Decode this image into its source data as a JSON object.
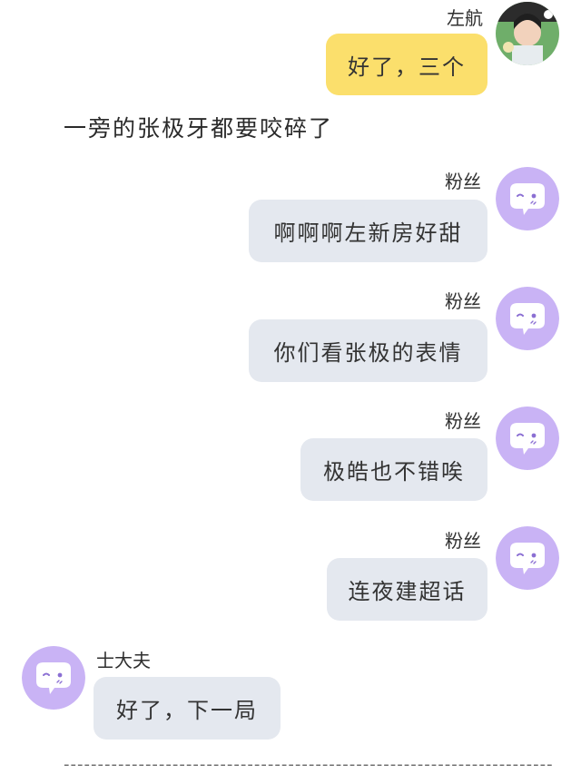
{
  "messages": [
    {
      "sender": "左航",
      "text": "好了，三个",
      "bubble_color": "#fbdf6c",
      "avatar": "photo-avatar"
    },
    {
      "sender": "粉丝",
      "text": "啊啊啊左新房好甜",
      "bubble_color": "#e4e8ef",
      "avatar": "purple-chat-avatar"
    },
    {
      "sender": "粉丝",
      "text": "你们看张极的表情",
      "bubble_color": "#e4e8ef",
      "avatar": "purple-chat-avatar"
    },
    {
      "sender": "粉丝",
      "text": "极皓也不错唉",
      "bubble_color": "#e4e8ef",
      "avatar": "purple-chat-avatar"
    },
    {
      "sender": "粉丝",
      "text": "连夜建超话",
      "bubble_color": "#e4e8ef",
      "avatar": "purple-chat-avatar"
    },
    {
      "sender": "士大夫",
      "text": "好了，下一局",
      "bubble_color": "#e4e8ef",
      "avatar": "purple-chat-avatar"
    }
  ],
  "narration": "一旁的张极牙都要咬碎了",
  "divider": "------------------------------------------------------------------------",
  "colors": {
    "avatar_purple": "#c9b3f5",
    "avatar_face": "#ffffff",
    "yellow_bubble": "#fbdf6c",
    "gray_bubble": "#e4e8ef"
  }
}
